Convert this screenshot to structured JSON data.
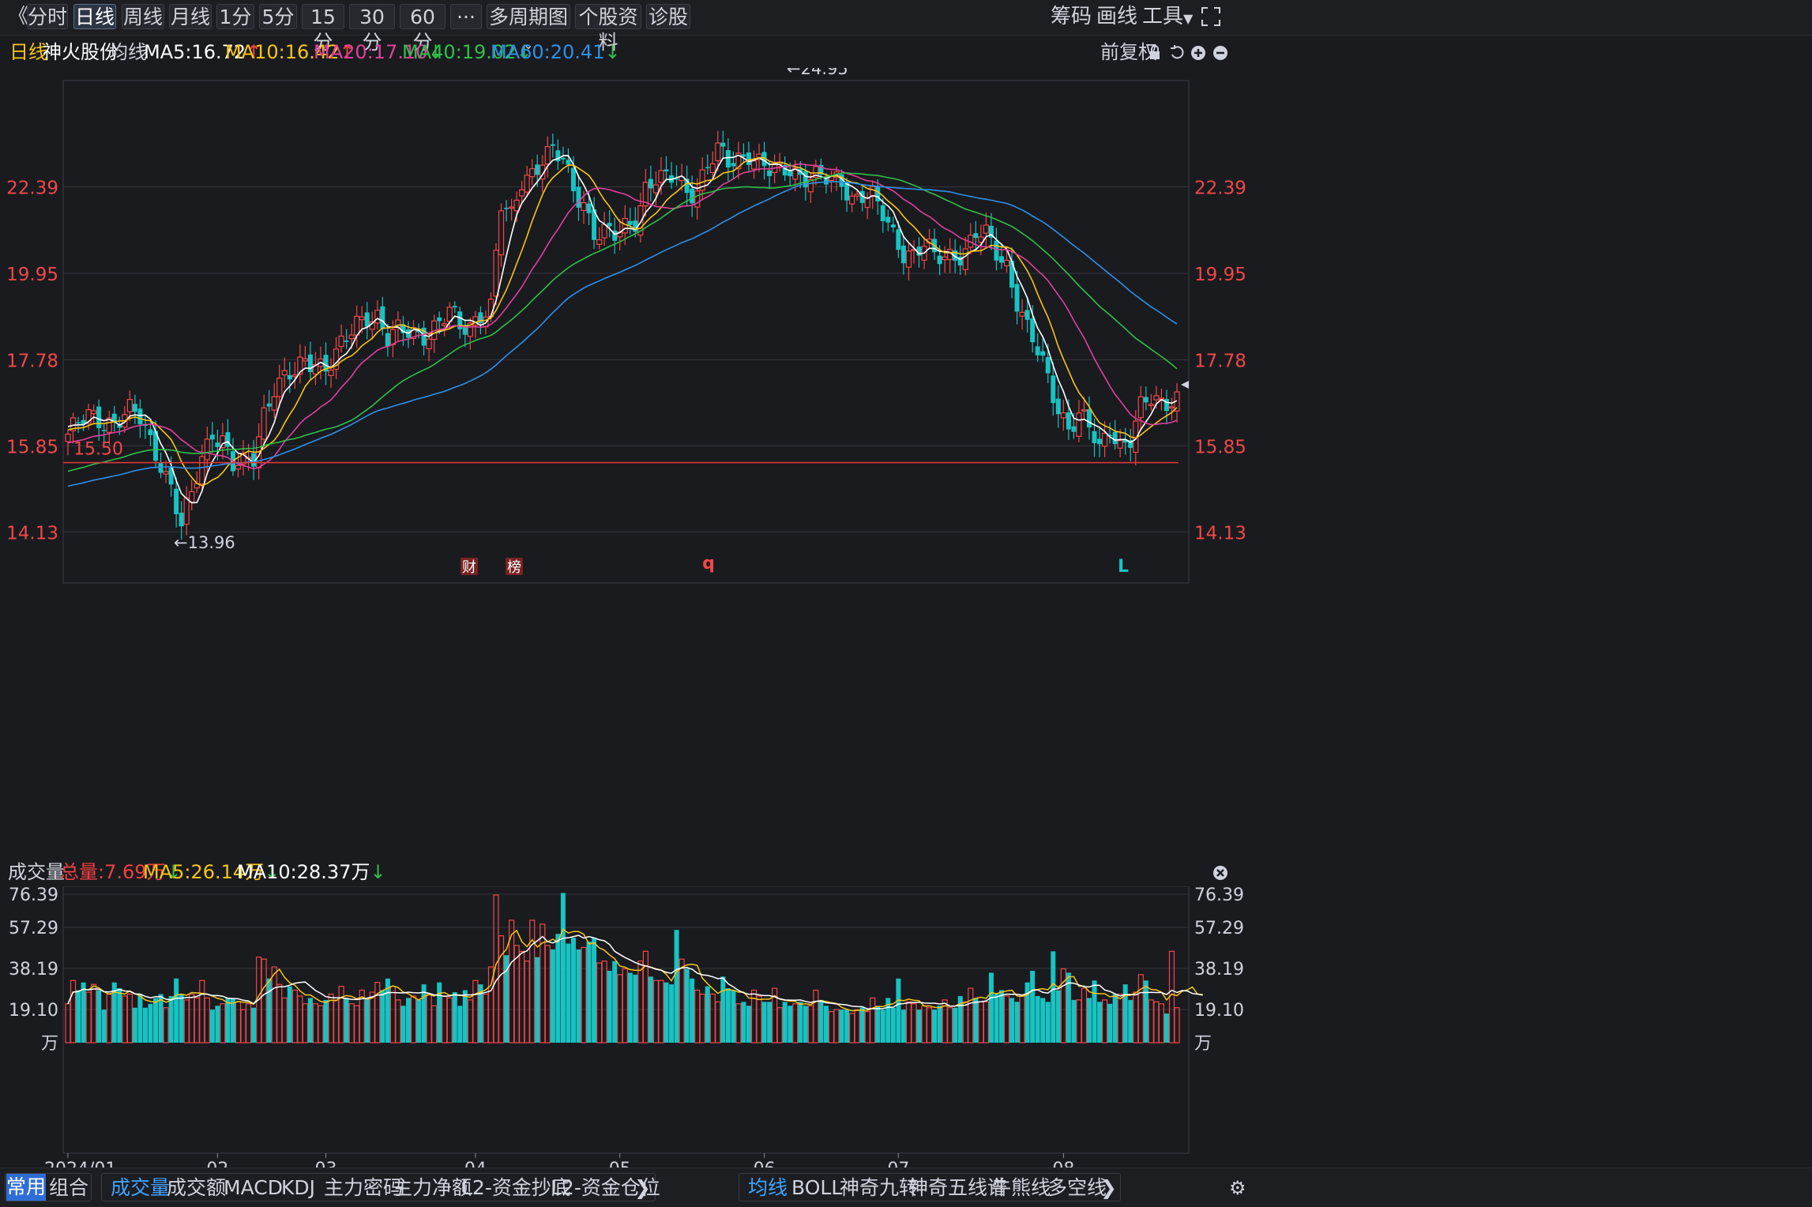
{
  "toolbar": {
    "back_glyph": "《",
    "tabs": [
      "分时",
      "日线",
      "周线",
      "月线",
      "1分",
      "5分",
      "15分",
      "30分",
      "60分",
      "···"
    ],
    "active_tab": "日线",
    "multi_period_label": "多周期图",
    "stock_info_label": "个股资料",
    "diagnose_label": "诊股",
    "right_labels": [
      "筹码",
      "画线",
      "工具"
    ],
    "fullscreen_icon": "fullscreen-icon"
  },
  "ma_bar": {
    "period_label": "日线",
    "stock_name": "神火股份",
    "ma_label": "均线",
    "ma5": "MA5:16.72",
    "ma10": "MA10:16.42",
    "ma20": "MA20:17.10",
    "ma40": "MA40:19.02",
    "ma60": "MA60:20.41",
    "adjust_label": "前复权",
    "colors": {
      "ma5": "#ffffff",
      "ma10": "#f5c518",
      "ma20": "#e0409c",
      "ma40": "#2fbf4a",
      "ma60": "#2f8fe8"
    }
  },
  "vol_bar": {
    "title": "成交量",
    "total": "总量:7.69万",
    "ma5": "MA5:26.14万",
    "ma10": "MA10:28.37万"
  },
  "chart_data": [
    {
      "type": "candlestick",
      "title": "神火股份 日线",
      "y_ticks": [
        "22.39",
        "19.95",
        "17.78",
        "15.85",
        "14.13"
      ],
      "y_tick_values": [
        22.39,
        19.95,
        17.78,
        15.85,
        14.13
      ],
      "ylim": [
        13.2,
        25.8
      ],
      "x_ticks": [
        "2024/01",
        "02",
        "03",
        "04",
        "05",
        "06",
        "07",
        "08"
      ],
      "x_tick_bar_index": [
        0,
        29,
        50,
        79,
        107,
        135,
        161,
        193
      ],
      "log_scale": true,
      "grid": true,
      "annotations": {
        "high": "←24.95",
        "low": "←13.96",
        "support_label": "15.50",
        "support_value": 15.5
      },
      "markers": [
        "财",
        "榜",
        "q",
        "L"
      ],
      "ohlc_anchors": [
        [
          0,
          16.1
        ],
        [
          4,
          16.45
        ],
        [
          9,
          16.4
        ],
        [
          12,
          16.55
        ],
        [
          14,
          16.4
        ],
        [
          16,
          15.95
        ],
        [
          18,
          15.55
        ],
        [
          20,
          15.0
        ],
        [
          22,
          14.2
        ],
        [
          24,
          14.8
        ],
        [
          26,
          15.6
        ],
        [
          28,
          16.2
        ],
        [
          30,
          16.0
        ],
        [
          32,
          15.4
        ],
        [
          34,
          15.4
        ],
        [
          36,
          15.6
        ],
        [
          38,
          16.6
        ],
        [
          40,
          17.2
        ],
        [
          42,
          17.3
        ],
        [
          44,
          17.4
        ],
        [
          46,
          17.7
        ],
        [
          48,
          17.8
        ],
        [
          50,
          17.65
        ],
        [
          52,
          17.9
        ],
        [
          54,
          18.2
        ],
        [
          56,
          18.6
        ],
        [
          58,
          18.9
        ],
        [
          60,
          18.9
        ],
        [
          62,
          18.3
        ],
        [
          64,
          18.4
        ],
        [
          66,
          18.4
        ],
        [
          68,
          18.4
        ],
        [
          70,
          18.5
        ],
        [
          72,
          18.7
        ],
        [
          74,
          18.9
        ],
        [
          76,
          18.5
        ],
        [
          78,
          18.6
        ],
        [
          80,
          19.0
        ],
        [
          82,
          19.1
        ],
        [
          84,
          21.8
        ],
        [
          86,
          21.4
        ],
        [
          88,
          22.6
        ],
        [
          90,
          22.9
        ],
        [
          92,
          23.3
        ],
        [
          94,
          23.4
        ],
        [
          96,
          23.1
        ],
        [
          98,
          22.3
        ],
        [
          100,
          22.0
        ],
        [
          102,
          21.1
        ],
        [
          104,
          21.0
        ],
        [
          106,
          20.9
        ],
        [
          108,
          21.2
        ],
        [
          110,
          21.5
        ],
        [
          112,
          22.4
        ],
        [
          114,
          22.6
        ],
        [
          116,
          22.5
        ],
        [
          118,
          22.7
        ],
        [
          120,
          22.3
        ],
        [
          122,
          22.4
        ],
        [
          124,
          23.0
        ],
        [
          126,
          23.4
        ],
        [
          128,
          23.1
        ],
        [
          130,
          23.3
        ],
        [
          132,
          23.5
        ],
        [
          134,
          23.1
        ],
        [
          136,
          22.8
        ],
        [
          138,
          22.8
        ],
        [
          140,
          23.0
        ],
        [
          142,
          22.8
        ],
        [
          144,
          22.7
        ],
        [
          146,
          22.6
        ],
        [
          148,
          22.5
        ],
        [
          150,
          22.6
        ],
        [
          152,
          22.1
        ],
        [
          154,
          22.2
        ],
        [
          156,
          22.0
        ],
        [
          158,
          21.5
        ],
        [
          160,
          21.0
        ],
        [
          162,
          20.6
        ],
        [
          164,
          20.5
        ],
        [
          166,
          20.7
        ],
        [
          168,
          20.3
        ],
        [
          170,
          20.4
        ],
        [
          172,
          20.5
        ],
        [
          174,
          20.6
        ],
        [
          176,
          21.0
        ],
        [
          178,
          20.9
        ],
        [
          180,
          20.5
        ],
        [
          182,
          20.2
        ],
        [
          184,
          19.3
        ],
        [
          186,
          18.5
        ],
        [
          188,
          17.9
        ],
        [
          190,
          17.3
        ],
        [
          192,
          16.7
        ],
        [
          194,
          16.3
        ],
        [
          196,
          16.5
        ],
        [
          198,
          16.2
        ],
        [
          200,
          15.7
        ],
        [
          202,
          16.3
        ],
        [
          204,
          15.9
        ],
        [
          206,
          16.0
        ],
        [
          208,
          16.6
        ],
        [
          210,
          16.85
        ],
        [
          212,
          16.8
        ],
        [
          214,
          16.95
        ]
      ]
    },
    {
      "type": "bar",
      "title": "成交量",
      "y_ticks": [
        "76.39",
        "57.29",
        "38.19",
        "19.10",
        "万"
      ],
      "y_tick_values": [
        76.39,
        57.29,
        38.19,
        19.1,
        0
      ],
      "ylim": [
        0,
        78
      ],
      "unit": "万",
      "values": [
        20,
        32,
        27,
        31,
        26,
        30,
        27,
        17,
        25,
        31,
        28,
        24,
        25,
        18,
        25,
        18,
        20,
        23,
        25,
        18,
        24,
        33,
        25,
        22,
        25,
        23,
        32,
        23,
        17,
        19,
        20,
        23,
        23,
        21,
        17,
        20,
        18,
        44,
        43,
        33,
        39,
        30,
        23,
        29,
        27,
        24,
        20,
        23,
        20,
        19,
        22,
        25,
        22,
        29,
        23,
        20,
        19,
        27,
        23,
        26,
        31,
        27,
        33,
        29,
        22,
        19,
        23,
        24,
        22,
        30,
        25,
        19,
        31,
        24,
        23,
        26,
        19,
        27,
        22,
        32,
        30,
        25,
        39,
        76,
        55,
        45,
        63,
        50,
        47,
        42,
        63,
        44,
        61,
        50,
        48,
        56,
        77,
        51,
        54,
        48,
        49,
        52,
        54,
        41,
        42,
        37,
        42,
        35,
        38,
        36,
        35,
        42,
        47,
        34,
        32,
        32,
        31,
        30,
        58,
        43,
        38,
        33,
        27,
        25,
        29,
        25,
        21,
        34,
        28,
        27,
        20,
        21,
        19,
        27,
        24,
        21,
        21,
        28,
        18,
        21,
        19,
        20,
        21,
        19,
        19,
        27,
        22,
        19,
        16,
        17,
        17,
        17,
        15,
        17,
        18,
        16,
        23,
        19,
        17,
        23,
        18,
        33,
        17,
        21,
        20,
        17,
        19,
        18,
        17,
        19,
        22,
        18,
        18,
        24,
        21,
        28,
        23,
        21,
        21,
        36,
        25,
        27,
        24,
        23,
        21,
        24,
        31,
        37,
        24,
        23,
        21,
        47,
        27,
        38,
        36,
        22,
        22,
        28,
        23,
        32,
        21,
        22,
        20,
        25,
        25,
        30,
        22,
        26,
        35,
        32,
        22,
        21,
        20,
        15,
        47,
        18,
        32,
        24,
        22,
        29,
        17
      ]
    }
  ],
  "chart_lines_ma_colors": [
    "#ffffff",
    "#f5c518",
    "#e0409c",
    "#2fbf4a",
    "#2f8fe8"
  ],
  "bottom_bar": {
    "left_tabs": [
      "常用",
      "组合"
    ],
    "indicator_tabs": [
      "成交量",
      "成交额",
      "MACD",
      "KDJ",
      "主力密码",
      "主力净额",
      "L2-资金抄底",
      "L2-资金仓位"
    ],
    "overlay_tabs": [
      "均线",
      "BOLL",
      "神奇九转",
      "神奇五线谱",
      "牛熊线",
      "多空线"
    ]
  }
}
